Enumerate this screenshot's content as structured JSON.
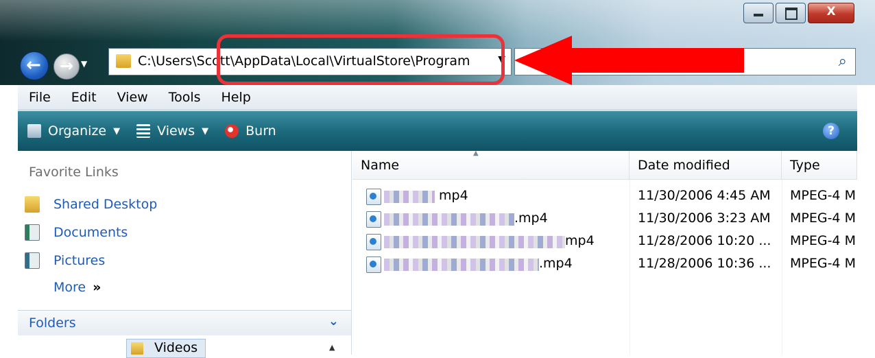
{
  "window": {
    "minimize_glyph": "–",
    "close_glyph": "X"
  },
  "address_bar": {
    "path": "C:\\Users\\Scott\\AppData\\Local\\VirtualStore\\Program"
  },
  "search": {
    "placeholder": ""
  },
  "menu": [
    "File",
    "Edit",
    "View",
    "Tools",
    "Help"
  ],
  "toolbar": {
    "organize": "Organize",
    "views": "Views",
    "burn": "Burn",
    "help_glyph": "?"
  },
  "navigation_pane": {
    "favorites_heading": "Favorite Links",
    "favorites": [
      "Shared Desktop",
      "Documents",
      "Pictures"
    ],
    "more": "More",
    "more_chevron": "»",
    "folders_label": "Folders",
    "tree_item": "Videos"
  },
  "file_list": {
    "columns": [
      "Name",
      "Date modified",
      "Type"
    ],
    "rows": [
      {
        "name_visible": "mp4",
        "date": "11/30/2006 4:45 AM",
        "type": "MPEG-4 M"
      },
      {
        "name_visible": ".mp4",
        "date": "11/30/2006 3:23 AM",
        "type": "MPEG-4 M"
      },
      {
        "name_visible": "mp4",
        "date": "11/28/2006 10:20 ...",
        "type": "MPEG-4 M"
      },
      {
        "name_visible": ".mp4",
        "date": "11/28/2006 10:36 ...",
        "type": "MPEG-4 M"
      }
    ]
  },
  "annotation": {
    "highlight_color": "#e8333a",
    "arrow_color": "#ff0000"
  }
}
